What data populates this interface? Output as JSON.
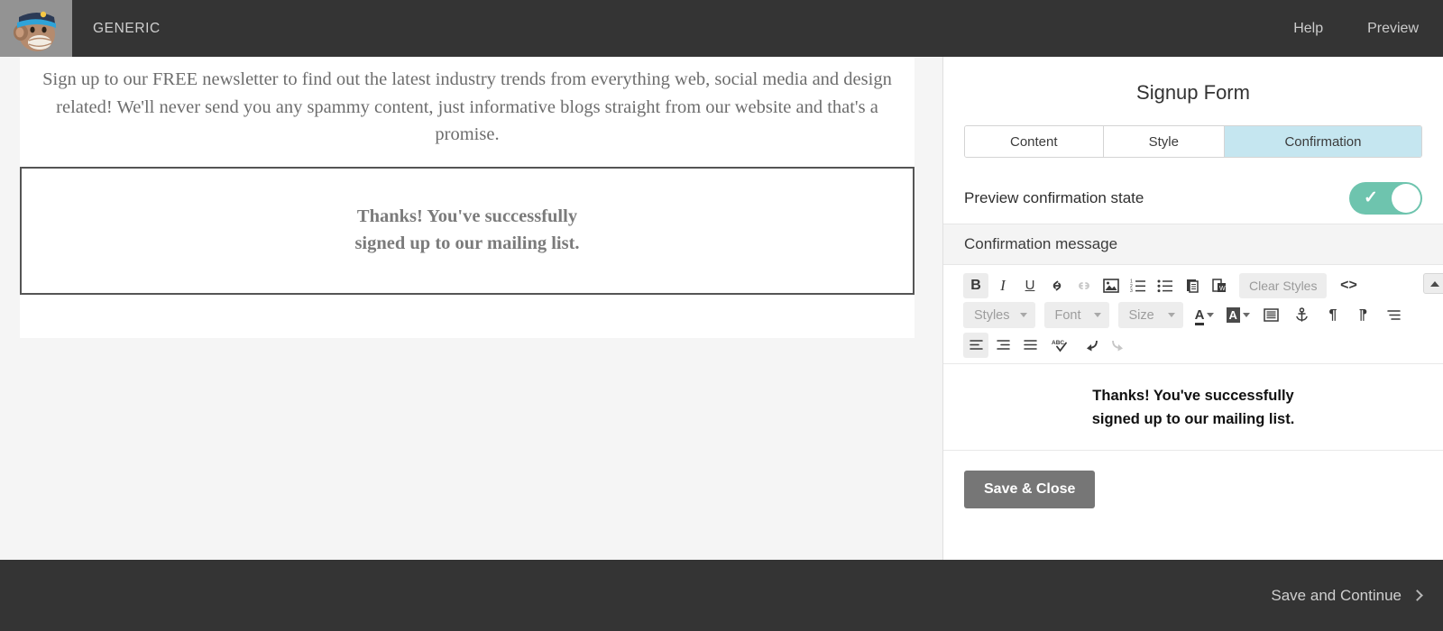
{
  "topbar": {
    "brand": "GENERIC",
    "logo_icon": "mailchimp-freddie-logo",
    "links": [
      {
        "label": "Help",
        "name": "help-link"
      },
      {
        "label": "Preview",
        "name": "preview-link"
      }
    ]
  },
  "preview": {
    "intro_text": "Sign up to our FREE newsletter to find out the latest industry trends from everything web, social media and design related! We'll never send you any spammy content, just informative blogs straight from our website and that's a promise.",
    "confirmation_lines": [
      "Thanks! You've successfully",
      "signed up to our mailing list."
    ]
  },
  "panel": {
    "title": "Signup Form",
    "tabs": [
      {
        "label": "Content",
        "active": false
      },
      {
        "label": "Style",
        "active": false
      },
      {
        "label": "Confirmation",
        "active": true
      }
    ],
    "toggle": {
      "label": "Preview confirmation state",
      "state": "on",
      "color": "#6ec4ae"
    },
    "section_header": "Confirmation message",
    "toolbar": {
      "row1": [
        {
          "name": "bold-icon",
          "glyph": "B",
          "state": "active"
        },
        {
          "name": "italic-icon",
          "glyph": "I",
          "state": "normal"
        },
        {
          "name": "underline-icon",
          "glyph": "U",
          "state": "normal"
        },
        {
          "name": "link-icon",
          "glyph": "link",
          "state": "normal"
        },
        {
          "name": "unlink-icon",
          "glyph": "unlink",
          "state": "disabled"
        },
        {
          "name": "image-icon",
          "glyph": "image",
          "state": "normal"
        },
        {
          "name": "ordered-list-icon",
          "glyph": "ol",
          "state": "normal"
        },
        {
          "name": "unordered-list-icon",
          "glyph": "ul",
          "state": "normal"
        },
        {
          "name": "paste-icon",
          "glyph": "paste",
          "state": "normal"
        },
        {
          "name": "paste-from-word-icon",
          "glyph": "paste-word",
          "state": "normal"
        },
        {
          "name": "clear-styles-button",
          "glyph": "Clear Styles",
          "state": "normal"
        },
        {
          "name": "source-code-icon",
          "glyph": "<>",
          "state": "normal"
        }
      ],
      "clear_styles_label": "Clear Styles",
      "source_label": "<>",
      "collapse_icon": "collapse-toolbar-icon",
      "selects": [
        {
          "name": "styles-select",
          "label": "Styles"
        },
        {
          "name": "font-select",
          "label": "Font"
        },
        {
          "name": "size-select",
          "label": "Size"
        }
      ],
      "row2_icons": [
        {
          "name": "text-color-icon"
        },
        {
          "name": "background-color-icon"
        },
        {
          "name": "block-format-icon"
        },
        {
          "name": "anchor-icon"
        },
        {
          "name": "ltr-direction-icon"
        },
        {
          "name": "rtl-direction-icon"
        },
        {
          "name": "line-height-icon"
        }
      ],
      "row3_icons": [
        {
          "name": "align-left-icon",
          "state": "active"
        },
        {
          "name": "align-right-icon",
          "state": "normal"
        },
        {
          "name": "align-justify-icon",
          "state": "normal"
        },
        {
          "name": "spellcheck-icon",
          "state": "normal"
        },
        {
          "name": "undo-icon",
          "state": "normal"
        },
        {
          "name": "redo-icon",
          "state": "disabled"
        }
      ]
    },
    "editor_lines": [
      "Thanks! You've successfully",
      "signed up to our mailing list."
    ],
    "save_close_label": "Save & Close"
  },
  "bottombar": {
    "save_continue_label": "Save and Continue",
    "chevron_icon": "chevron-right-icon"
  }
}
